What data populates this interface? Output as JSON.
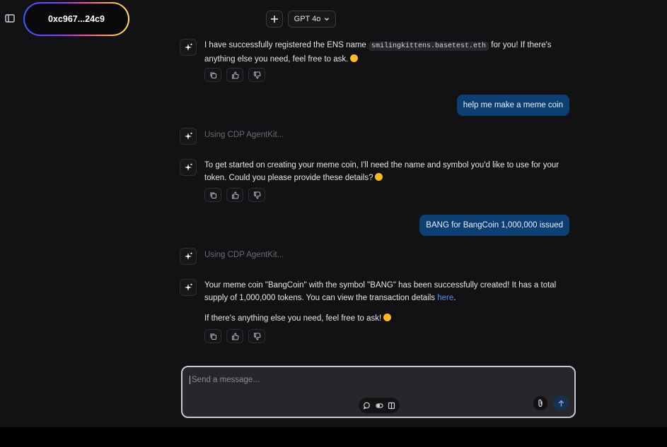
{
  "header": {
    "wallet_address": "0xc967...24c9",
    "model_label": "GPT 4o"
  },
  "icons": {
    "sidebar_toggle": "sidebar-icon",
    "new_chat": "plus-icon",
    "model_dropdown": "chevron-down-icon",
    "assistant_avatar": "sparkles-icon",
    "copy": "copy-icon",
    "upvote": "thumbs-up-icon",
    "downvote": "thumbs-down-icon",
    "attach": "paperclip-icon",
    "send": "arrow-up-icon"
  },
  "messages": [
    {
      "role": "assistant",
      "text_before": "I have successfully registered the ENS name ",
      "code": "smilingkittens.basetest.eth",
      "text_after": " for you! If there's anything else you need, feel free to ask."
    },
    {
      "role": "user",
      "text": "help me make a meme coin"
    },
    {
      "role": "assistant-status",
      "text": "Using CDP AgentKit..."
    },
    {
      "role": "assistant",
      "text": "To get started on creating your meme coin, I'll need the name and symbol you'd like to use for your token. Could you please provide these details?"
    },
    {
      "role": "user",
      "text": "BANG for BangCoin 1,000,000 issued"
    },
    {
      "role": "assistant-status",
      "text": "Using CDP AgentKit..."
    },
    {
      "role": "assistant",
      "text_before": "Your meme coin \"BangCoin\" with the symbol \"BANG\" has been successfully created! It has a total supply of 1,000,000 tokens. You can view the transaction details ",
      "link": "here",
      "text_after": ".",
      "followup": "If there's anything else you need, feel free to ask!"
    }
  ],
  "composer": {
    "placeholder": "Send a message..."
  },
  "colors": {
    "background": "#121214",
    "user_bubble": "#0d3f73",
    "link": "#4f8cff",
    "wallet_gradient": [
      "#3b5bff",
      "#8a3cff",
      "#ff4fa0",
      "#ffb84d",
      "#ffe26b"
    ]
  }
}
